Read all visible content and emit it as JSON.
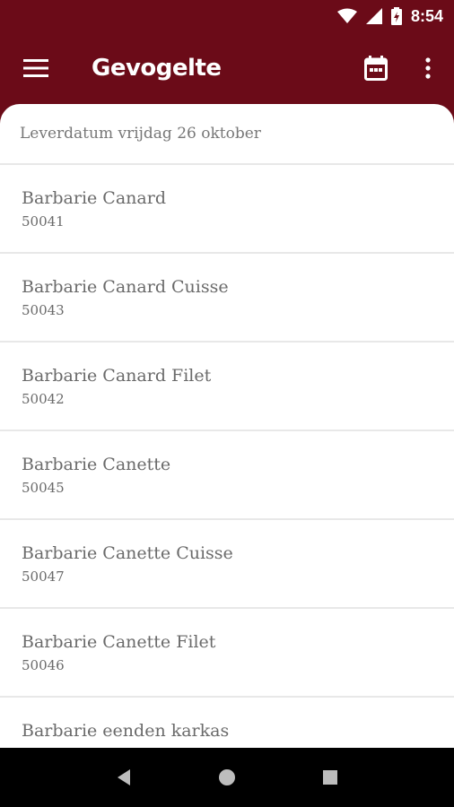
{
  "status_bar": {
    "time": "8:54",
    "icons": [
      "wifi-icon",
      "cell-signal-icon",
      "battery-charging-icon"
    ]
  },
  "app_bar": {
    "title": "Gevogelte",
    "menu_icon": "menu-icon",
    "calendar_icon": "calendar-icon",
    "overflow_icon": "more-vert-icon",
    "color": "#6b0b18"
  },
  "delivery_date_label": "Leverdatum vrijdag 26 oktober",
  "products": [
    {
      "name": "Barbarie Canard",
      "code": "50041"
    },
    {
      "name": "Barbarie Canard Cuisse",
      "code": "50043"
    },
    {
      "name": "Barbarie Canard Filet",
      "code": "50042"
    },
    {
      "name": "Barbarie Canette",
      "code": "50045"
    },
    {
      "name": "Barbarie Canette Cuisse",
      "code": "50047"
    },
    {
      "name": "Barbarie Canette Filet",
      "code": "50046"
    },
    {
      "name": "Barbarie eenden karkas",
      "code": ""
    }
  ],
  "nav_bar": {
    "buttons": [
      "back-icon",
      "home-icon",
      "recents-icon"
    ]
  }
}
